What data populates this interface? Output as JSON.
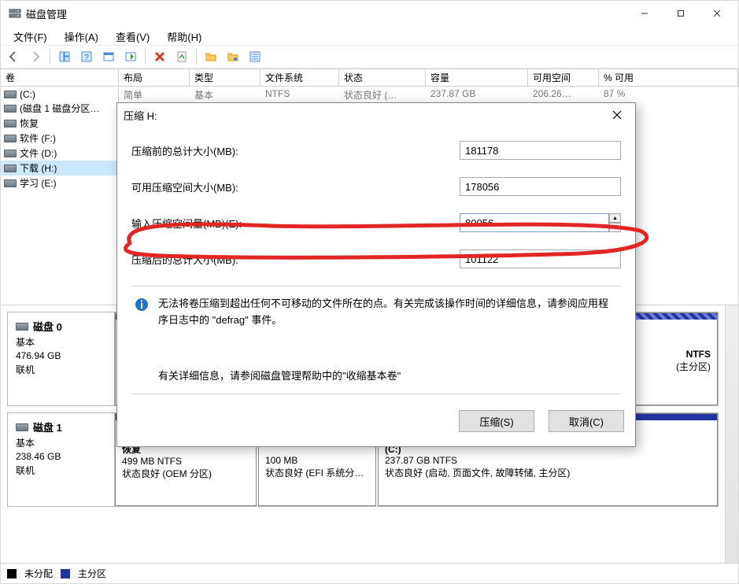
{
  "window": {
    "title": "磁盘管理"
  },
  "menu": {
    "file": "文件(F)",
    "action": "操作(A)",
    "view": "查看(V)",
    "help": "帮助(H)"
  },
  "columns": {
    "volume": "卷",
    "layout": "布局",
    "type": "类型",
    "filesystem": "文件系统",
    "status": "状态",
    "capacity": "容量",
    "free": "可用空间",
    "pctfree": "% 可用"
  },
  "volumes": {
    "c": "(C:)",
    "d1": "(磁盘 1 磁盘分区…",
    "recover": "恢复",
    "soft": "软件 (F:)",
    "file": "文件 (D:)",
    "download": "下载 (H:)",
    "study": "学习 (E:)"
  },
  "row_peek": {
    "layout": "简单",
    "type": "基本",
    "fs": "NTFS",
    "status": "状态良好 (…",
    "capacity": "237.87 GB",
    "free": "206.26…",
    "pct": "87 %"
  },
  "disks": {
    "d0": {
      "name": "磁盘 0",
      "kind": "基本",
      "size": "476.94 GB",
      "state": "联机",
      "part_right_title": "NTFS",
      "part_right_status": "(主分区)"
    },
    "d1": {
      "name": "磁盘 1",
      "kind": "基本",
      "size": "238.46 GB",
      "state": "联机",
      "p1_size": "499 MB NTFS",
      "p1_status": "状态良好 (OEM 分区)",
      "p2_size": "100 MB",
      "p2_status": "状态良好 (EFI 系统分…",
      "p3_size": "237.87 GB NTFS",
      "p3_status": "状态良好 (启动, 页面文件, 故障转储, 主分区)",
      "p1_title": "恢复",
      "p3_title": "(C:)"
    }
  },
  "legend": {
    "unalloc": "未分配",
    "primary": "主分区"
  },
  "dialog": {
    "title": "压缩 H:",
    "label_total_before": "压缩前的总计大小(MB):",
    "label_avail": "可用压缩空间大小(MB):",
    "label_input_amount": "输入压缩空间量(MB)(E):",
    "label_total_after": "压缩后的总计大小(MB):",
    "val_total_before": "181178",
    "val_avail": "178056",
    "val_input": "80056",
    "val_total_after": "101122",
    "info_text": "无法将卷压缩到超出任何不可移动的文件所在的点。有关完成该操作时间的详细信息，请参阅应用程序日志中的 \"defrag\" 事件。",
    "info_help": "有关详细信息，请参阅磁盘管理帮助中的\"收缩基本卷\"",
    "btn_shrink": "压缩(S)",
    "btn_cancel": "取消(C)"
  }
}
